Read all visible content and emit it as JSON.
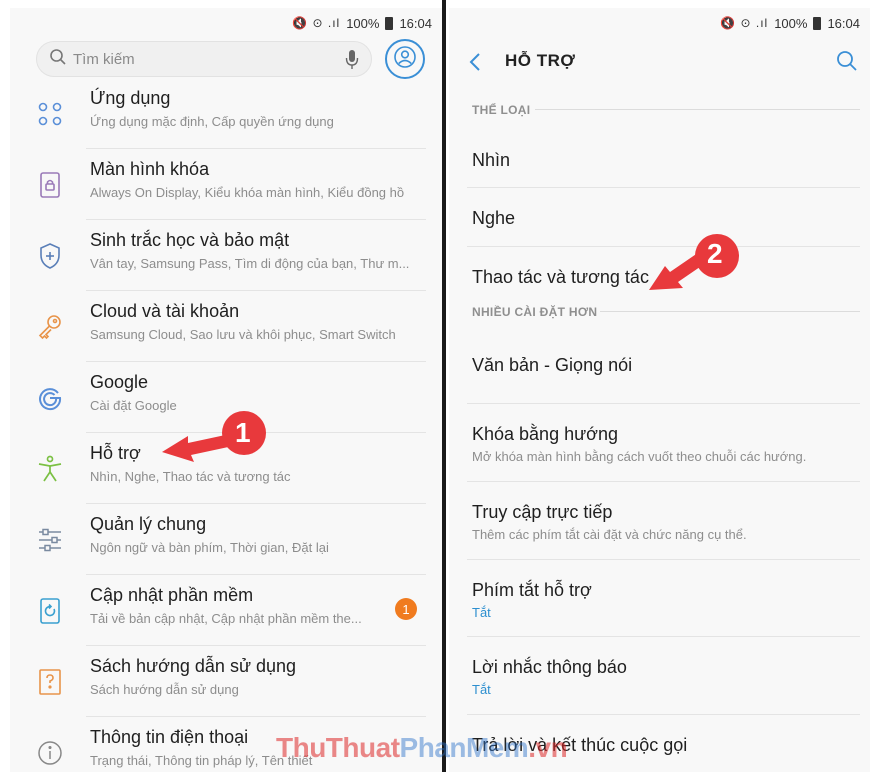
{
  "status": {
    "icons": "🔇 ⊙ .ıl",
    "battery": "100%",
    "time": "16:04"
  },
  "left": {
    "search": {
      "placeholder": "Tìm kiếm"
    },
    "items": [
      {
        "title": "Ứng dụng",
        "subtitle": "Ứng dụng mặc định, Cấp quyền ứng dụng",
        "icon": "apps-icon"
      },
      {
        "title": "Màn hình khóa",
        "subtitle": "Always On Display, Kiểu khóa màn hình, Kiểu đồng hồ",
        "icon": "lock-screen-icon"
      },
      {
        "title": "Sinh trắc học và bảo mật",
        "subtitle": "Vân tay, Samsung Pass, Tìm di động của bạn, Thư m...",
        "icon": "shield-icon"
      },
      {
        "title": "Cloud và tài khoản",
        "subtitle": "Samsung Cloud, Sao lưu và khôi phục, Smart Switch",
        "icon": "key-icon"
      },
      {
        "title": "Google",
        "subtitle": "Cài đặt Google",
        "icon": "google-icon"
      },
      {
        "title": "Hỗ trợ",
        "subtitle": "Nhìn, Nghe, Thao tác và tương tác",
        "icon": "accessibility-icon"
      },
      {
        "title": "Quản lý chung",
        "subtitle": "Ngôn ngữ và bàn phím, Thời gian, Đặt lại",
        "icon": "sliders-icon"
      },
      {
        "title": "Cập nhật phần mềm",
        "subtitle": "Tải về bản cập nhật, Cập nhật phần mềm the...",
        "icon": "update-icon",
        "badge": "1"
      },
      {
        "title": "Sách hướng dẫn sử dụng",
        "subtitle": "Sách hướng dẫn sử dụng",
        "icon": "manual-icon"
      },
      {
        "title": "Thông tin điện thoại",
        "subtitle": "Trạng thái, Thông tin pháp lý, Tên thiết",
        "icon": "info-icon"
      }
    ],
    "annotation": "1"
  },
  "right": {
    "title": "HỖ TRỢ",
    "section1": "THỂ LOẠI",
    "section2": "NHIỀU CÀI ĐẶT HƠN",
    "cat_items": [
      "Nhìn",
      "Nghe",
      "Thao tác và tương tác"
    ],
    "more_items": [
      {
        "title": "Văn bản - Giọng nói",
        "subtitle": ""
      },
      {
        "title": "Khóa bằng hướng",
        "subtitle": "Mở khóa màn hình bằng cách vuốt theo chuỗi các hướng."
      },
      {
        "title": "Truy cập trực tiếp",
        "subtitle": "Thêm các phím tắt cài đặt và chức năng cụ thể."
      },
      {
        "title": "Phím tắt hỗ trợ",
        "subtitle": "Tắt"
      },
      {
        "title": "Lời nhắc thông báo",
        "subtitle": "Tắt"
      },
      {
        "title": "Trả lời và kết thúc cuộc gọi",
        "subtitle": ""
      }
    ],
    "annotation": "2"
  },
  "watermark": {
    "part1": "ThuThuat",
    "part2": "PhanMem",
    "part3": ".vn"
  },
  "colors": {
    "accent": "#3a8fd6",
    "badge": "#f07b1f",
    "annotation": "#e8393c",
    "accessibility": "#7bc043"
  }
}
